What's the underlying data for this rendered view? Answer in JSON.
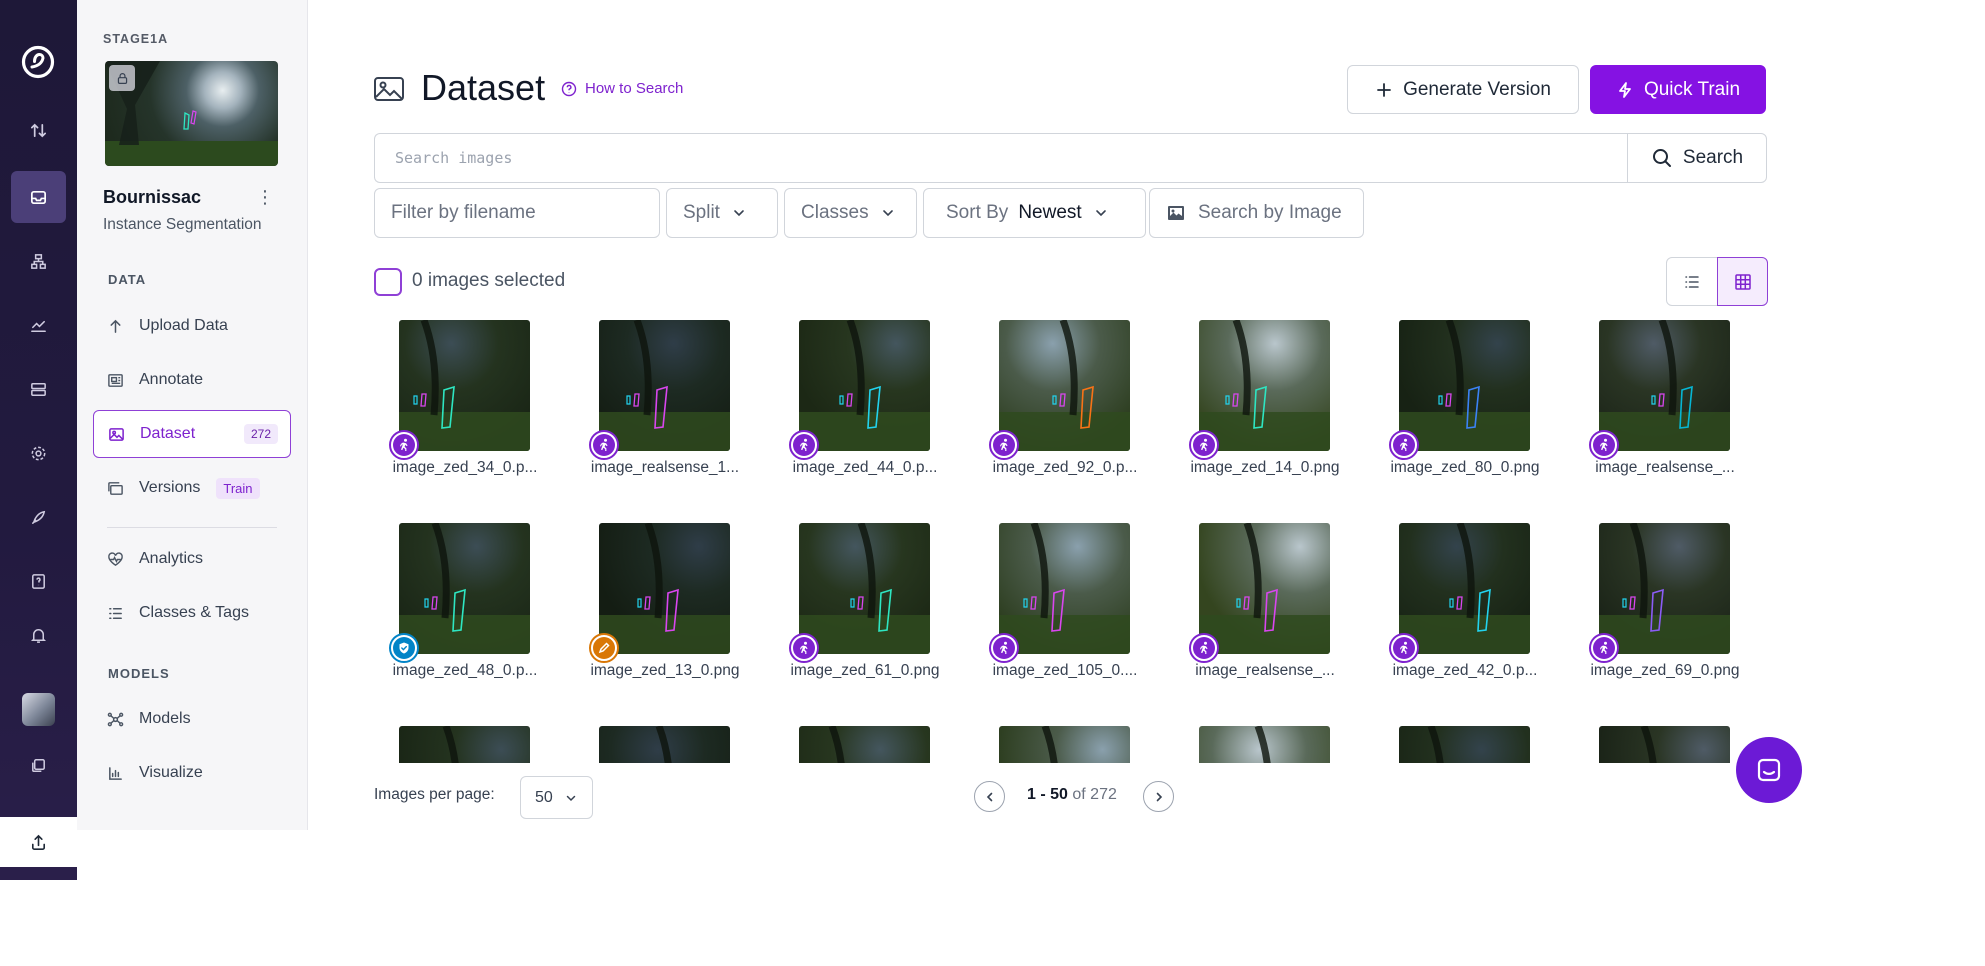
{
  "project": {
    "workspace_tag": "STAGE1A",
    "name": "Bournissac",
    "type": "Instance Segmentation"
  },
  "sidebar": {
    "data_heading": "DATA",
    "models_heading": "MODELS",
    "items": [
      {
        "label": "Upload Data",
        "icon": "upload-arrow-icon"
      },
      {
        "label": "Annotate",
        "icon": "annotate-icon"
      },
      {
        "label": "Dataset",
        "icon": "image-icon",
        "count": "272"
      },
      {
        "label": "Versions",
        "icon": "versions-icon",
        "badge": "Train"
      },
      {
        "label": "Analytics",
        "icon": "analytics-icon"
      },
      {
        "label": "Classes & Tags",
        "icon": "list-icon"
      },
      {
        "label": "Models",
        "icon": "models-icon"
      },
      {
        "label": "Visualize",
        "icon": "chart-icon"
      }
    ]
  },
  "header": {
    "title": "Dataset",
    "how_to_search": "How to Search",
    "generate_version": "Generate Version",
    "quick_train": "Quick Train"
  },
  "search": {
    "placeholder": "Search images",
    "button": "Search"
  },
  "filters": {
    "filename_placeholder": "Filter by filename",
    "split": "Split",
    "classes": "Classes",
    "sort_label": "Sort By",
    "sort_value": "Newest",
    "search_by_image": "Search by Image"
  },
  "selection": {
    "label": "0 images selected"
  },
  "images": [
    {
      "name": "image_zed_34_0.p...",
      "badge": "person-icon",
      "badge_color": "#7e22ce"
    },
    {
      "name": "image_realsense_1...",
      "badge": "person-icon",
      "badge_color": "#7e22ce"
    },
    {
      "name": "image_zed_44_0.p...",
      "badge": "person-icon",
      "badge_color": "#7e22ce"
    },
    {
      "name": "image_zed_92_0.p...",
      "badge": "person-icon",
      "badge_color": "#7e22ce"
    },
    {
      "name": "image_zed_14_0.png",
      "badge": "person-icon",
      "badge_color": "#7e22ce"
    },
    {
      "name": "image_zed_80_0.png",
      "badge": "person-icon",
      "badge_color": "#7e22ce"
    },
    {
      "name": "image_realsense_...",
      "badge": "person-icon",
      "badge_color": "#7e22ce"
    },
    {
      "name": "image_zed_48_0.p...",
      "badge": "shield-check-icon",
      "badge_color": "#0284c7"
    },
    {
      "name": "image_zed_13_0.png",
      "badge": "pencil-icon",
      "badge_color": "#d97706"
    },
    {
      "name": "image_zed_61_0.png",
      "badge": "person-icon",
      "badge_color": "#7e22ce"
    },
    {
      "name": "image_zed_105_0....",
      "badge": "person-icon",
      "badge_color": "#7e22ce"
    },
    {
      "name": "image_realsense_...",
      "badge": "person-icon",
      "badge_color": "#7e22ce"
    },
    {
      "name": "image_zed_42_0.p...",
      "badge": "person-icon",
      "badge_color": "#7e22ce"
    },
    {
      "name": "image_zed_69_0.png",
      "badge": "person-icon",
      "badge_color": "#7e22ce"
    },
    {
      "name": "",
      "badge": "",
      "badge_color": ""
    },
    {
      "name": "",
      "badge": "",
      "badge_color": ""
    },
    {
      "name": "",
      "badge": "",
      "badge_color": ""
    },
    {
      "name": "",
      "badge": "",
      "badge_color": ""
    },
    {
      "name": "",
      "badge": "",
      "badge_color": ""
    },
    {
      "name": "",
      "badge": "",
      "badge_color": ""
    },
    {
      "name": "",
      "badge": "",
      "badge_color": ""
    }
  ],
  "pagination": {
    "per_page_label": "Images per page:",
    "per_page_value": "50",
    "range": "1 - 50",
    "of_label": "of 272"
  },
  "colors": {
    "accent": "#8512e3",
    "rail_bg": "#221a3f"
  }
}
